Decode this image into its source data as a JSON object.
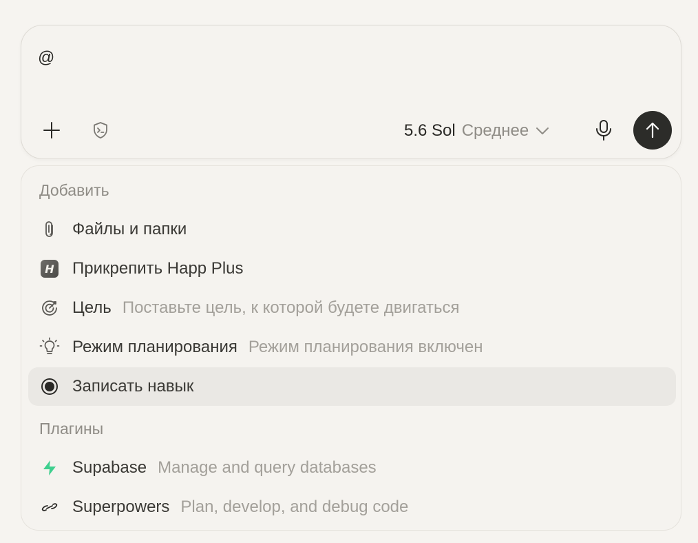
{
  "composer": {
    "input_value": "@",
    "model": {
      "name": "5.6 Sol",
      "effort": "Среднее"
    },
    "icons": {
      "add": "plus-icon",
      "sandbox": "shield-terminal-icon",
      "mic": "microphone-icon",
      "send": "arrow-up-icon"
    }
  },
  "menu": {
    "sections": [
      {
        "label": "Добавить",
        "items": [
          {
            "label": "Файлы и папки",
            "description": "",
            "icon": "paperclip-icon"
          },
          {
            "label": "Прикрепить Happ Plus",
            "description": "",
            "icon": "happ-plus-icon",
            "badge": "H"
          },
          {
            "label": "Цель",
            "description": "Поставьте цель, к которой будете двигаться",
            "icon": "target-icon"
          },
          {
            "label": "Режим планирования",
            "description": "Режим планирования включен",
            "icon": "lightbulb-icon"
          },
          {
            "label": "Записать навык",
            "description": "",
            "icon": "record-icon",
            "active": true
          }
        ]
      },
      {
        "label": "Плагины",
        "items": [
          {
            "label": "Supabase",
            "description": "Manage and query databases",
            "icon": "supabase-bolt-icon"
          },
          {
            "label": "Superpowers",
            "description": "Plan, develop, and debug code",
            "icon": "superpowers-link-icon"
          }
        ]
      }
    ]
  },
  "colors": {
    "background": "#f6f4f0",
    "panel": "#f5f3ef",
    "active_row": "#eae8e4",
    "send_button": "#2c2c29",
    "supabase_green": "#3ecf8e",
    "muted_text": "#a3a09a"
  }
}
